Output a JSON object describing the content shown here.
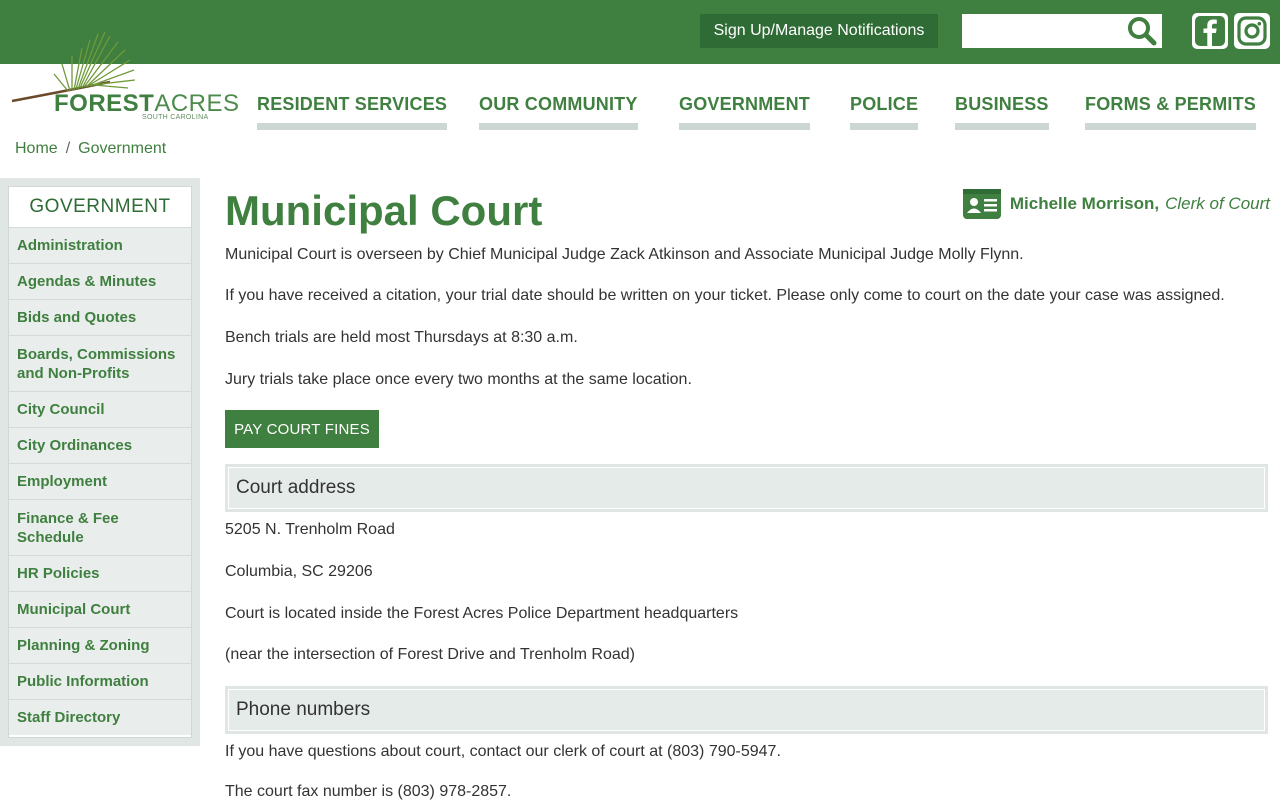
{
  "header": {
    "notify_label": "Sign Up/Manage Notifications",
    "search_placeholder": "",
    "icons": [
      "search-icon",
      "facebook-icon",
      "instagram-icon"
    ]
  },
  "logo": {
    "name_bold": "FOREST",
    "name_light": "ACRES",
    "subtitle": "SOUTH CAROLINA"
  },
  "nav": {
    "items": [
      "RESIDENT SERVICES",
      "OUR COMMUNITY",
      "GOVERNMENT",
      "POLICE",
      "BUSINESS",
      "FORMS & PERMITS"
    ]
  },
  "breadcrumb": {
    "home": "Home",
    "separator": "/",
    "current": "Government"
  },
  "sidebar": {
    "title": "GOVERNMENT",
    "items": [
      "Administration",
      "Agendas & Minutes",
      "Bids and Quotes",
      "Boards, Commissions and Non-Profits",
      "City Council",
      "City Ordinances",
      "Employment",
      "Finance & Fee Schedule",
      "HR Policies",
      "Municipal Court",
      "Planning & Zoning",
      "Public Information",
      "Staff Directory"
    ]
  },
  "page": {
    "title": "Municipal Court",
    "contact_name": "Michelle Morrison,",
    "contact_role": "Clerk of Court",
    "intro": [
      "Municipal Court is overseen by Chief Municipal Judge Zack Atkinson and Associate Municipal Judge Molly Flynn.",
      "If you have received a citation, your trial date should be written on your ticket. Please only come to court on the date your case was assigned.",
      "Bench trials are held most Thursdays at 8:30 a.m.",
      "Jury trials take place once every two months at the same location."
    ],
    "pay_button": "PAY COURT FINES",
    "address_heading": "Court address",
    "address_lines": [
      "5205 N. Trenholm Road",
      "Columbia, SC 29206",
      "Court is located inside the Forest Acres Police Department headquarters",
      "(near the intersection of Forest Drive and Trenholm Road)"
    ],
    "phone_heading": "Phone numbers",
    "phone_lines": [
      "If you have questions about court, contact our clerk of court at (803) 790-5947.",
      "The court fax number is (803) 978-2857."
    ]
  },
  "colors": {
    "brand_green": "#3f7f3f",
    "dark_green": "#2f6b35",
    "panel_gray": "#dfe6e3"
  }
}
